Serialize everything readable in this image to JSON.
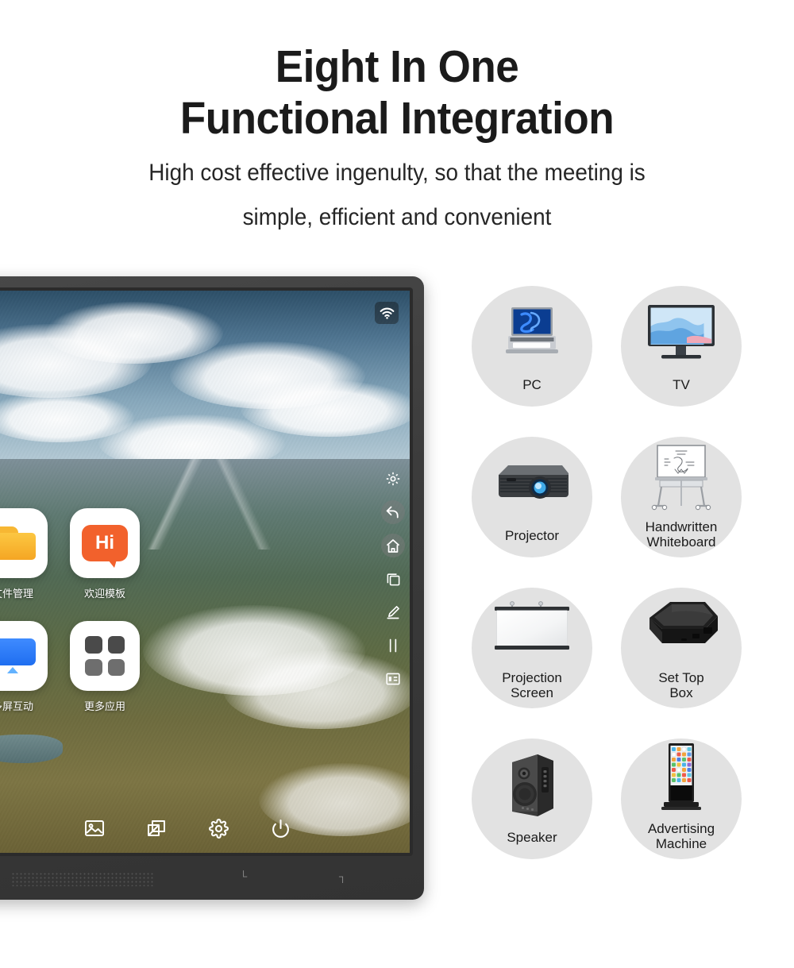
{
  "header": {
    "title_line1": "Eight In One",
    "title_line2": "Functional Integration",
    "subtitle_line1": "High cost effective ingenulty, so that the meeting is",
    "subtitle_line2": "simple, efficient and convenient"
  },
  "colors": {
    "title": "#1b1b1b",
    "subtitle": "#262626",
    "circle_bg": "#e2e2e2",
    "bezel": "#3a3a3a",
    "accent_orange": "#f2612c",
    "accent_blue": "#1f6ef0",
    "accent_yellow": "#f5a623"
  },
  "display": {
    "status": {
      "wifi_icon": "wifi-icon"
    },
    "apps": [
      {
        "label": "文件管理",
        "icon": "folder-icon"
      },
      {
        "label": "欢迎模板",
        "icon": "hi-bubble-icon",
        "glyph_text": "Hi"
      },
      {
        "label": "多屏互动",
        "icon": "screen-cast-icon"
      },
      {
        "label": "更多应用",
        "icon": "app-grid-icon"
      }
    ],
    "side_toolbar": [
      {
        "icon": "gear-icon"
      },
      {
        "icon": "back-arrow-icon"
      },
      {
        "icon": "home-icon"
      },
      {
        "icon": "recent-apps-icon"
      },
      {
        "icon": "pen-annotate-icon"
      },
      {
        "icon": "tools-icon"
      },
      {
        "icon": "sidebar-panel-icon"
      }
    ],
    "bottom_toolbar": [
      {
        "icon": "gallery-image-icon"
      },
      {
        "icon": "screen-share-icon"
      },
      {
        "icon": "settings-gear-icon"
      },
      {
        "icon": "power-icon"
      }
    ],
    "chin": {
      "mark_left": "└",
      "mark_right": "┐"
    }
  },
  "features": [
    {
      "label": "PC",
      "label_l1": "PC",
      "label_l2": "",
      "icon": "laptop-icon"
    },
    {
      "label": "TV",
      "label_l1": "TV",
      "label_l2": "",
      "icon": "monitor-icon"
    },
    {
      "label": "Projector",
      "label_l1": "Projector",
      "label_l2": "",
      "icon": "projector-icon"
    },
    {
      "label": "Handwritten Whiteboard",
      "label_l1": "Handwritten",
      "label_l2": "Whiteboard",
      "icon": "whiteboard-easel-icon"
    },
    {
      "label": "Projection Screen",
      "label_l1": "Projection",
      "label_l2": "Screen",
      "icon": "projection-screen-icon"
    },
    {
      "label": "Set Top Box",
      "label_l1": "Set Top",
      "label_l2": "Box",
      "icon": "set-top-box-icon"
    },
    {
      "label": "Speaker",
      "label_l1": "Speaker",
      "label_l2": "",
      "icon": "speaker-icon"
    },
    {
      "label": "Advertising Machine",
      "label_l1": "Advertising",
      "label_l2": "Machine",
      "icon": "digital-signage-icon"
    }
  ]
}
